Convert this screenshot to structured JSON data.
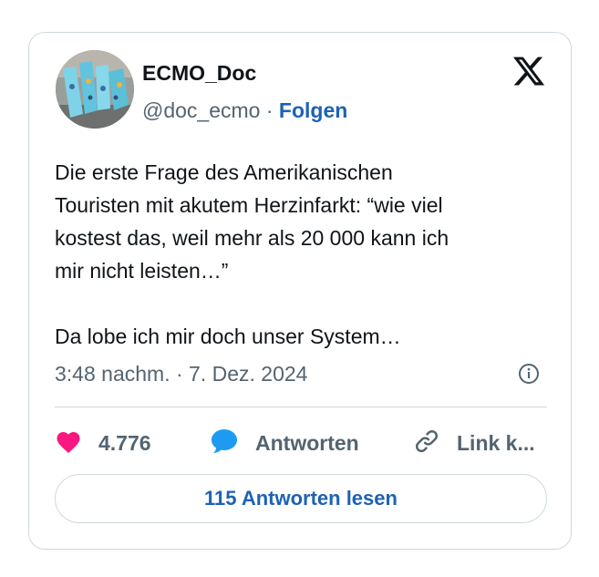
{
  "tweet": {
    "author": {
      "display_name": "ECMO_Doc",
      "handle": "@doc_ecmo",
      "separator": "·",
      "follow_label": "Folgen"
    },
    "text": "Die erste Frage des Amerikanischen\nTouristen mit akutem Herzinfarkt: “wie viel\nkostest das, weil mehr als 20 000 kann ich\nmir nicht leisten…”\n\nDa lobe ich mir doch unser System…",
    "timestamp": "3:48 nachm. · 7. Dez. 2024",
    "actions": {
      "like_count": "4.776",
      "reply_label": "Antworten",
      "link_label": "Link k..."
    },
    "read_replies_label": "115 Antworten lesen"
  },
  "icons": {
    "platform_logo": "x-logo-icon",
    "info": "info-icon",
    "like": "heart-icon",
    "reply": "speech-bubble-icon",
    "link": "link-icon"
  },
  "colors": {
    "like_heart": "#f91880",
    "reply_bubble": "#1d9bf0",
    "link_accent": "#1d62b5",
    "secondary_text": "#536471",
    "border": "#cfd9de"
  }
}
